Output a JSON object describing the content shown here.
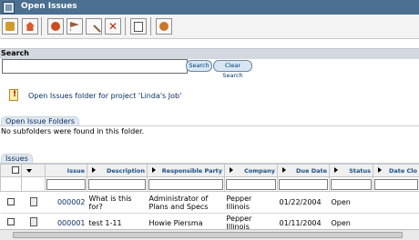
{
  "window": {
    "title": "Open Issues"
  },
  "toolbar": {
    "buttons": [
      "new-issue-icon",
      "home-icon",
      "edit-icon",
      "flag-icon",
      "link-icon",
      "delete-icon",
      "check-icon",
      "settings-icon"
    ]
  },
  "search": {
    "label": "Search",
    "value": "",
    "search_button": "Search",
    "clear_button": "Clear Search"
  },
  "info": {
    "text": "Open Issues folder for project 'Linda's Job'"
  },
  "folders": {
    "tab_label": "Open Issue Folders",
    "empty_text": "No subfolders were found in this folder."
  },
  "issues": {
    "tab_label": "Issues",
    "columns": [
      "Issue",
      "Description",
      "Responsible Party",
      "Company",
      "Due Date",
      "Status",
      "Date Clo"
    ],
    "rows": [
      {
        "issue": "000002",
        "description": "What is this for?",
        "responsible": "Administrator of Plans and Specs",
        "company": "Pepper Illinois",
        "due": "01/22/2004",
        "status": "Open",
        "closed": ""
      },
      {
        "issue": "000001",
        "description": "test 1-11",
        "responsible": "Howie Piersma",
        "company": "Pepper Illinois",
        "due": "01/11/2004",
        "status": "Open",
        "closed": ""
      }
    ]
  }
}
